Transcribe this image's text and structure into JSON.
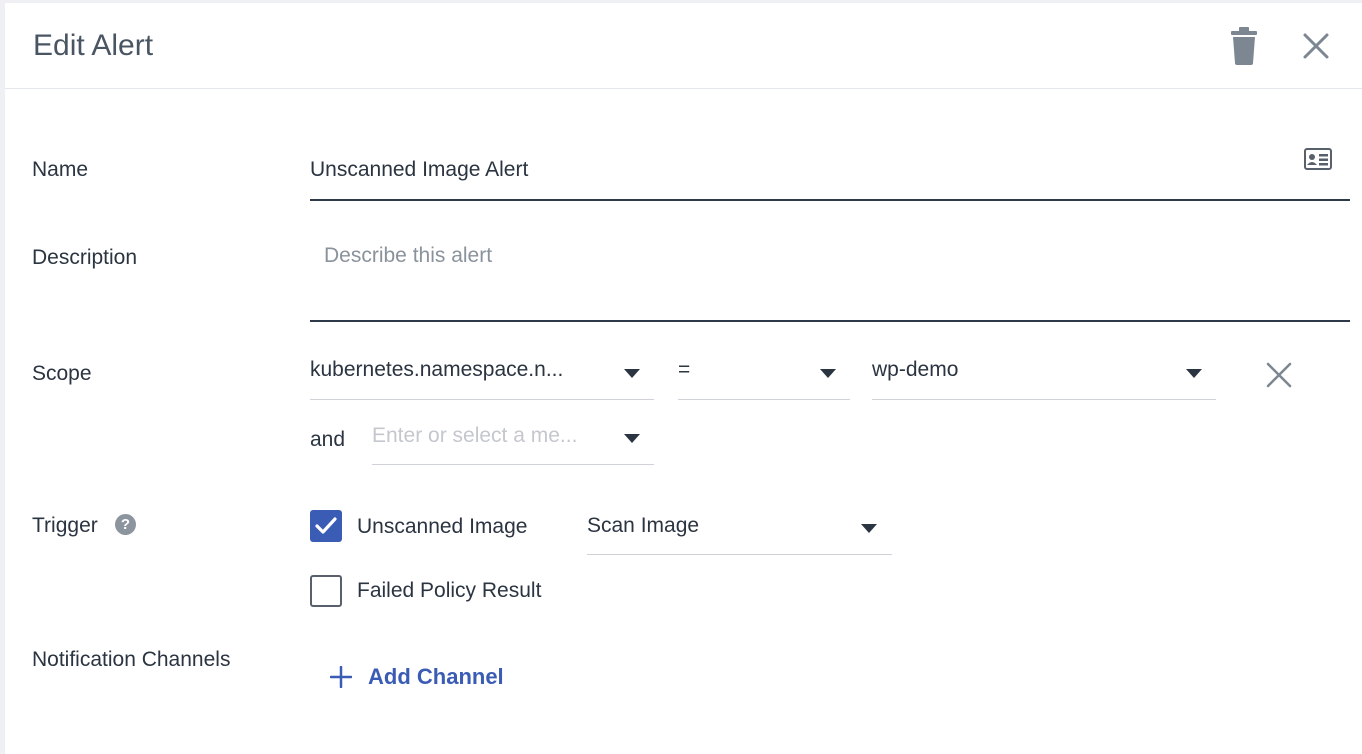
{
  "header": {
    "title": "Edit Alert",
    "delete_icon": "trash-icon",
    "close_icon": "close-icon"
  },
  "name": {
    "label": "Name",
    "value": "Unscanned Image Alert",
    "icon": "id-card-icon"
  },
  "description": {
    "label": "Description",
    "placeholder": "Describe this alert"
  },
  "scope": {
    "label": "Scope",
    "key": "kubernetes.namespace.n...",
    "operator": "=",
    "value": "wp-demo",
    "and_label": "and",
    "and_placeholder": "Enter or select a me..."
  },
  "trigger": {
    "label": "Trigger",
    "help_icon": "?",
    "options": [
      {
        "label": "Unscanned Image",
        "checked": true
      },
      {
        "label": "Failed Policy Result",
        "checked": false
      }
    ],
    "action": "Scan Image"
  },
  "notifications": {
    "label": "Notification Channels",
    "add_label": "Add Channel"
  },
  "colors": {
    "accent": "#3b5cb5",
    "text": "#2b3441",
    "muted": "#8a929c"
  }
}
